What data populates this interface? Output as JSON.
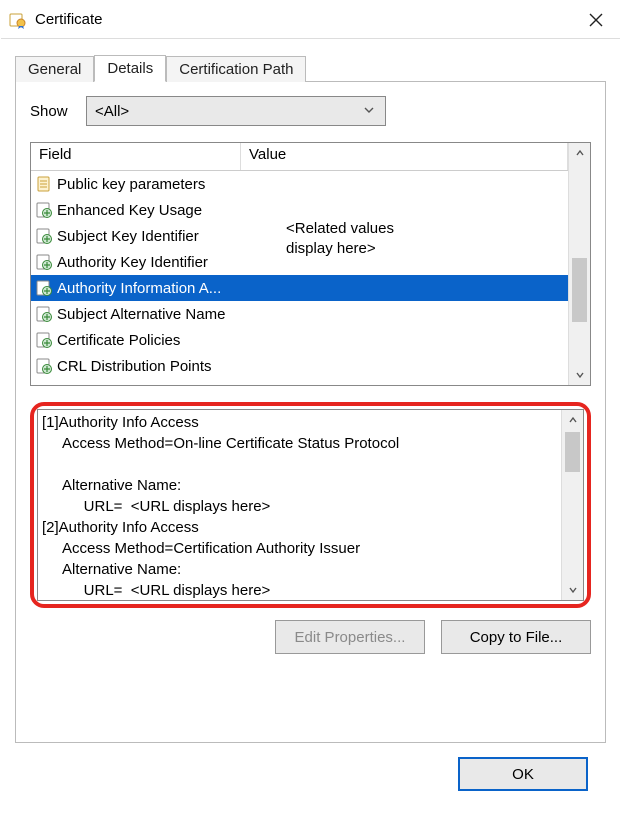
{
  "window": {
    "title": "Certificate"
  },
  "tabs": [
    {
      "label": "General",
      "active": false
    },
    {
      "label": "Details",
      "active": true
    },
    {
      "label": "Certification Path",
      "active": false
    }
  ],
  "show": {
    "label": "Show",
    "selected": "<All>"
  },
  "list": {
    "columns": {
      "field": "Field",
      "value": "Value"
    },
    "value_placeholder_line1": "<Related values",
    "value_placeholder_line2": "display here>",
    "rows": [
      {
        "field": "Public key parameters",
        "icon": "doc",
        "selected": false
      },
      {
        "field": "Enhanced Key Usage",
        "icon": "ext",
        "selected": false
      },
      {
        "field": "Subject Key Identifier",
        "icon": "ext",
        "selected": false
      },
      {
        "field": "Authority Key Identifier",
        "icon": "ext",
        "selected": false
      },
      {
        "field": "Authority Information A...",
        "icon": "ext",
        "selected": true
      },
      {
        "field": "Subject Alternative Name",
        "icon": "ext",
        "selected": false
      },
      {
        "field": "Certificate Policies",
        "icon": "ext",
        "selected": false
      },
      {
        "field": "CRL Distribution Points",
        "icon": "ext",
        "selected": false
      }
    ]
  },
  "details_text": "[1]Authority Info Access\n     Access Method=On-line Certificate Status Protocol\n\n     Alternative Name:\n          URL=  <URL displays here>\n[2]Authority Info Access\n     Access Method=Certification Authority Issuer\n     Alternative Name:\n          URL=  <URL displays here>",
  "buttons": {
    "edit_properties": "Edit Properties...",
    "copy_to_file": "Copy to File...",
    "ok": "OK"
  }
}
